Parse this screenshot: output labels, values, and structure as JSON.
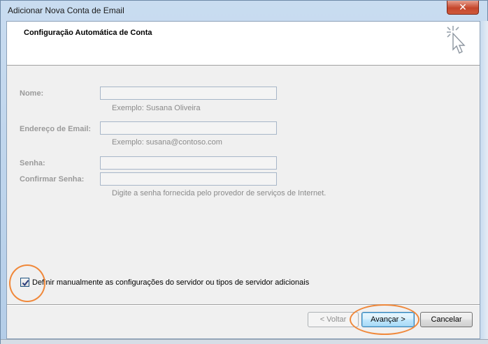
{
  "window": {
    "title": "Adicionar Nova Conta de Email",
    "close_glyph": "✕"
  },
  "header": {
    "title": "Configuração Automática de Conta",
    "icon": "sparkle-cursor-icon"
  },
  "form": {
    "name_label": "Nome:",
    "name_value": "",
    "name_hint": "Exemplo: Susana Oliveira",
    "email_label": "Endereço de Email:",
    "email_value": "",
    "email_hint": "Exemplo: susana@contoso.com",
    "password_label": "Senha:",
    "password_value": "",
    "confirm_label": "Confirmar Senha:",
    "confirm_value": "",
    "password_hint": "Digite a senha fornecida pelo provedor de serviços de Internet."
  },
  "manual_config": {
    "checked": true,
    "label": "Definir manualmente as configurações do servidor ou tipos de servidor adicionais"
  },
  "buttons": {
    "back": "< Voltar",
    "next": "Avançar >",
    "cancel": "Cancelar"
  },
  "colors": {
    "annotation": "#f0883a",
    "primary_button": "#bee6fd"
  }
}
